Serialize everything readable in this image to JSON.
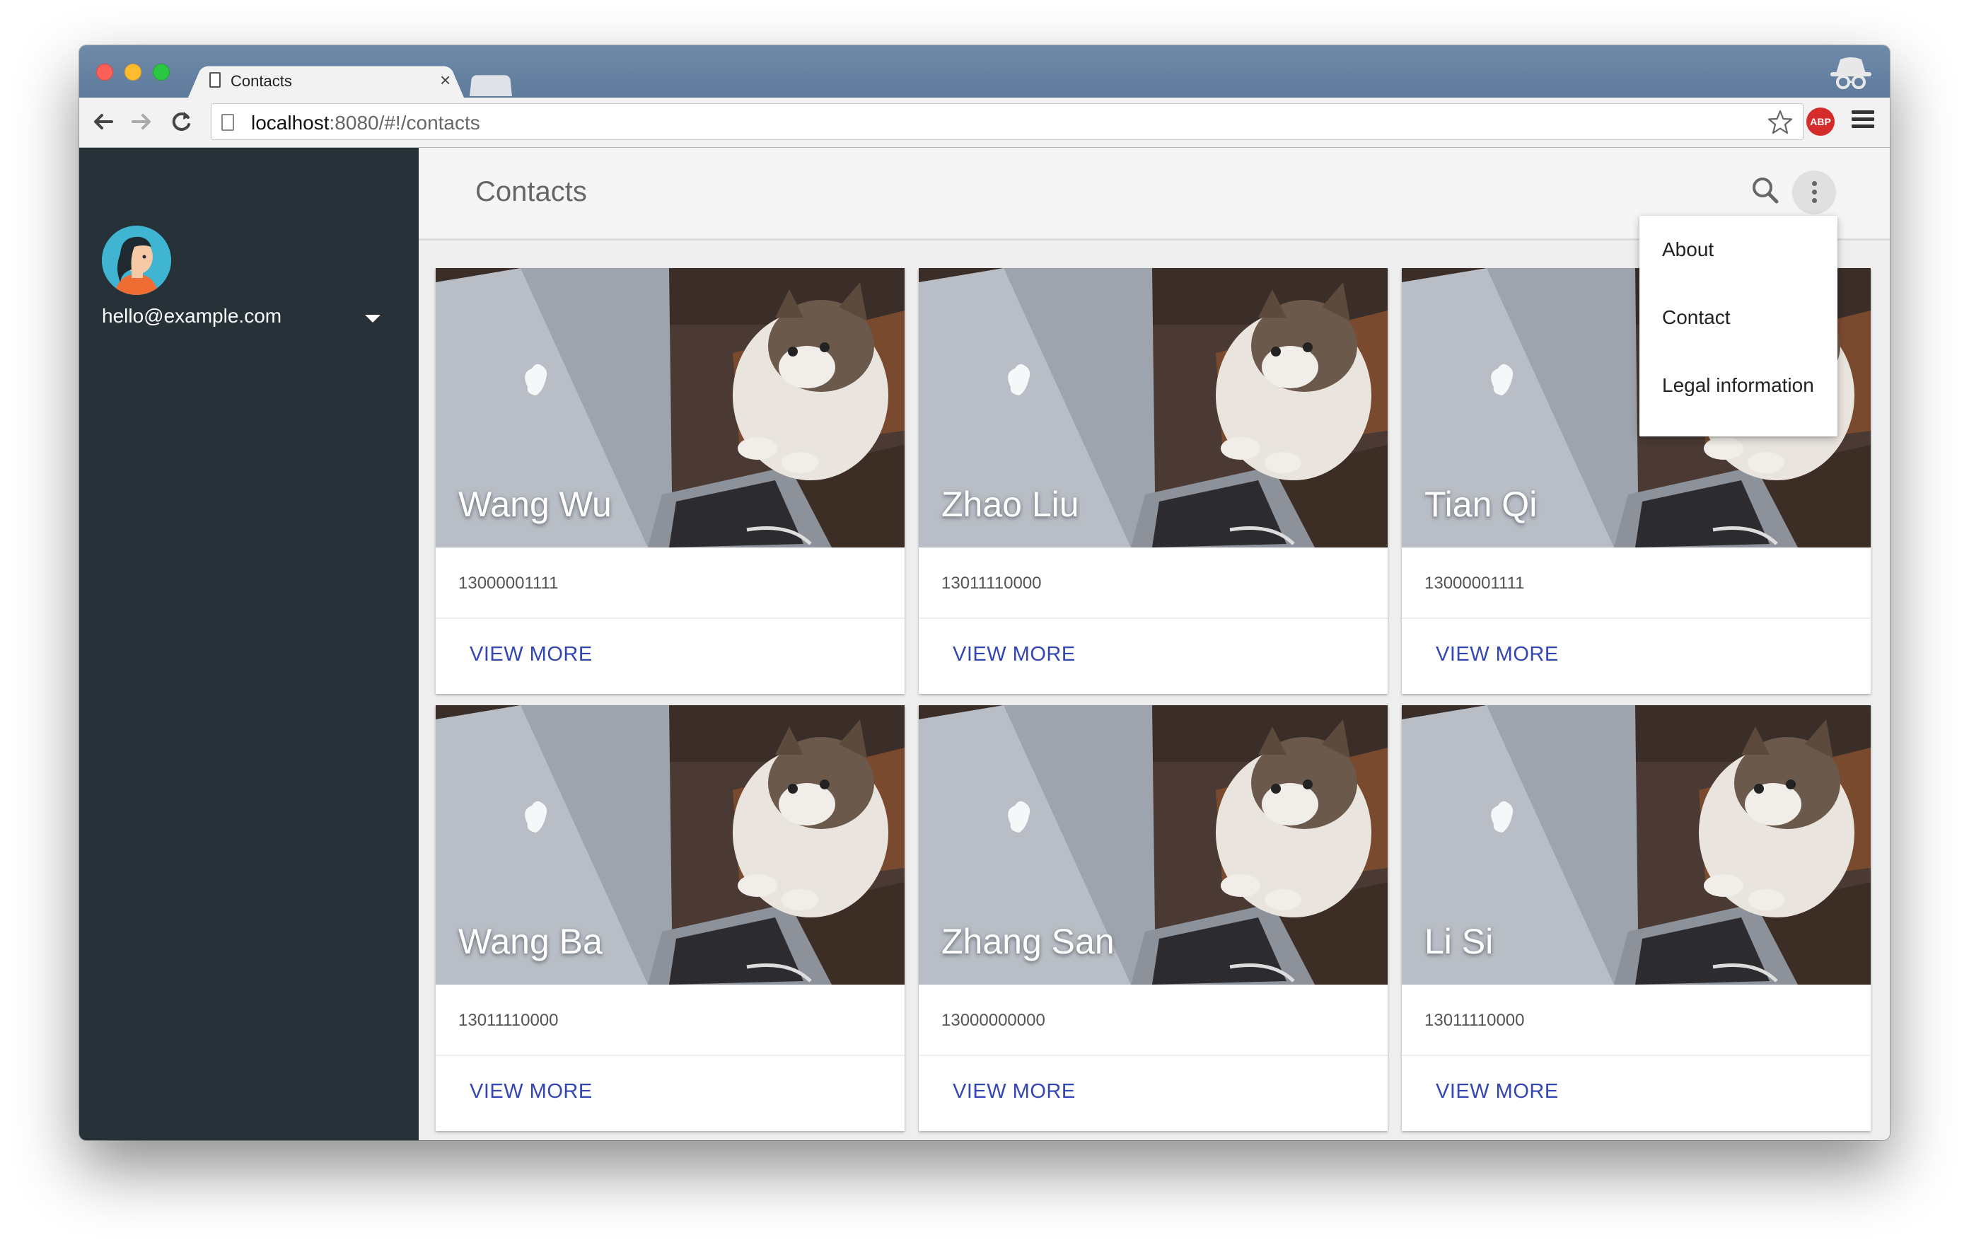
{
  "browser": {
    "tab_title": "Contacts",
    "tab_close": "×",
    "url_host": "localhost",
    "url_rest": ":8080/#!/contacts",
    "extension_label": "ABP"
  },
  "sidebar": {
    "email": "hello@example.com"
  },
  "header": {
    "title": "Contacts"
  },
  "menu": {
    "items": [
      "About",
      "Contact",
      "Legal information"
    ]
  },
  "contacts": [
    {
      "name": "Wang Wu",
      "phone": "13000001111",
      "action": "VIEW MORE"
    },
    {
      "name": "Zhao Liu",
      "phone": "13011110000",
      "action": "VIEW MORE"
    },
    {
      "name": "Tian Qi",
      "phone": "13000001111",
      "action": "VIEW MORE"
    },
    {
      "name": "Wang Ba",
      "phone": "13011110000",
      "action": "VIEW MORE"
    },
    {
      "name": "Zhang San",
      "phone": "13000000000",
      "action": "VIEW MORE"
    },
    {
      "name": "Li Si",
      "phone": "13011110000",
      "action": "VIEW MORE"
    }
  ],
  "colors": {
    "sidebar_bg": "#263238",
    "accent": "#3346b2",
    "tabbar": "#6f8aa9"
  }
}
